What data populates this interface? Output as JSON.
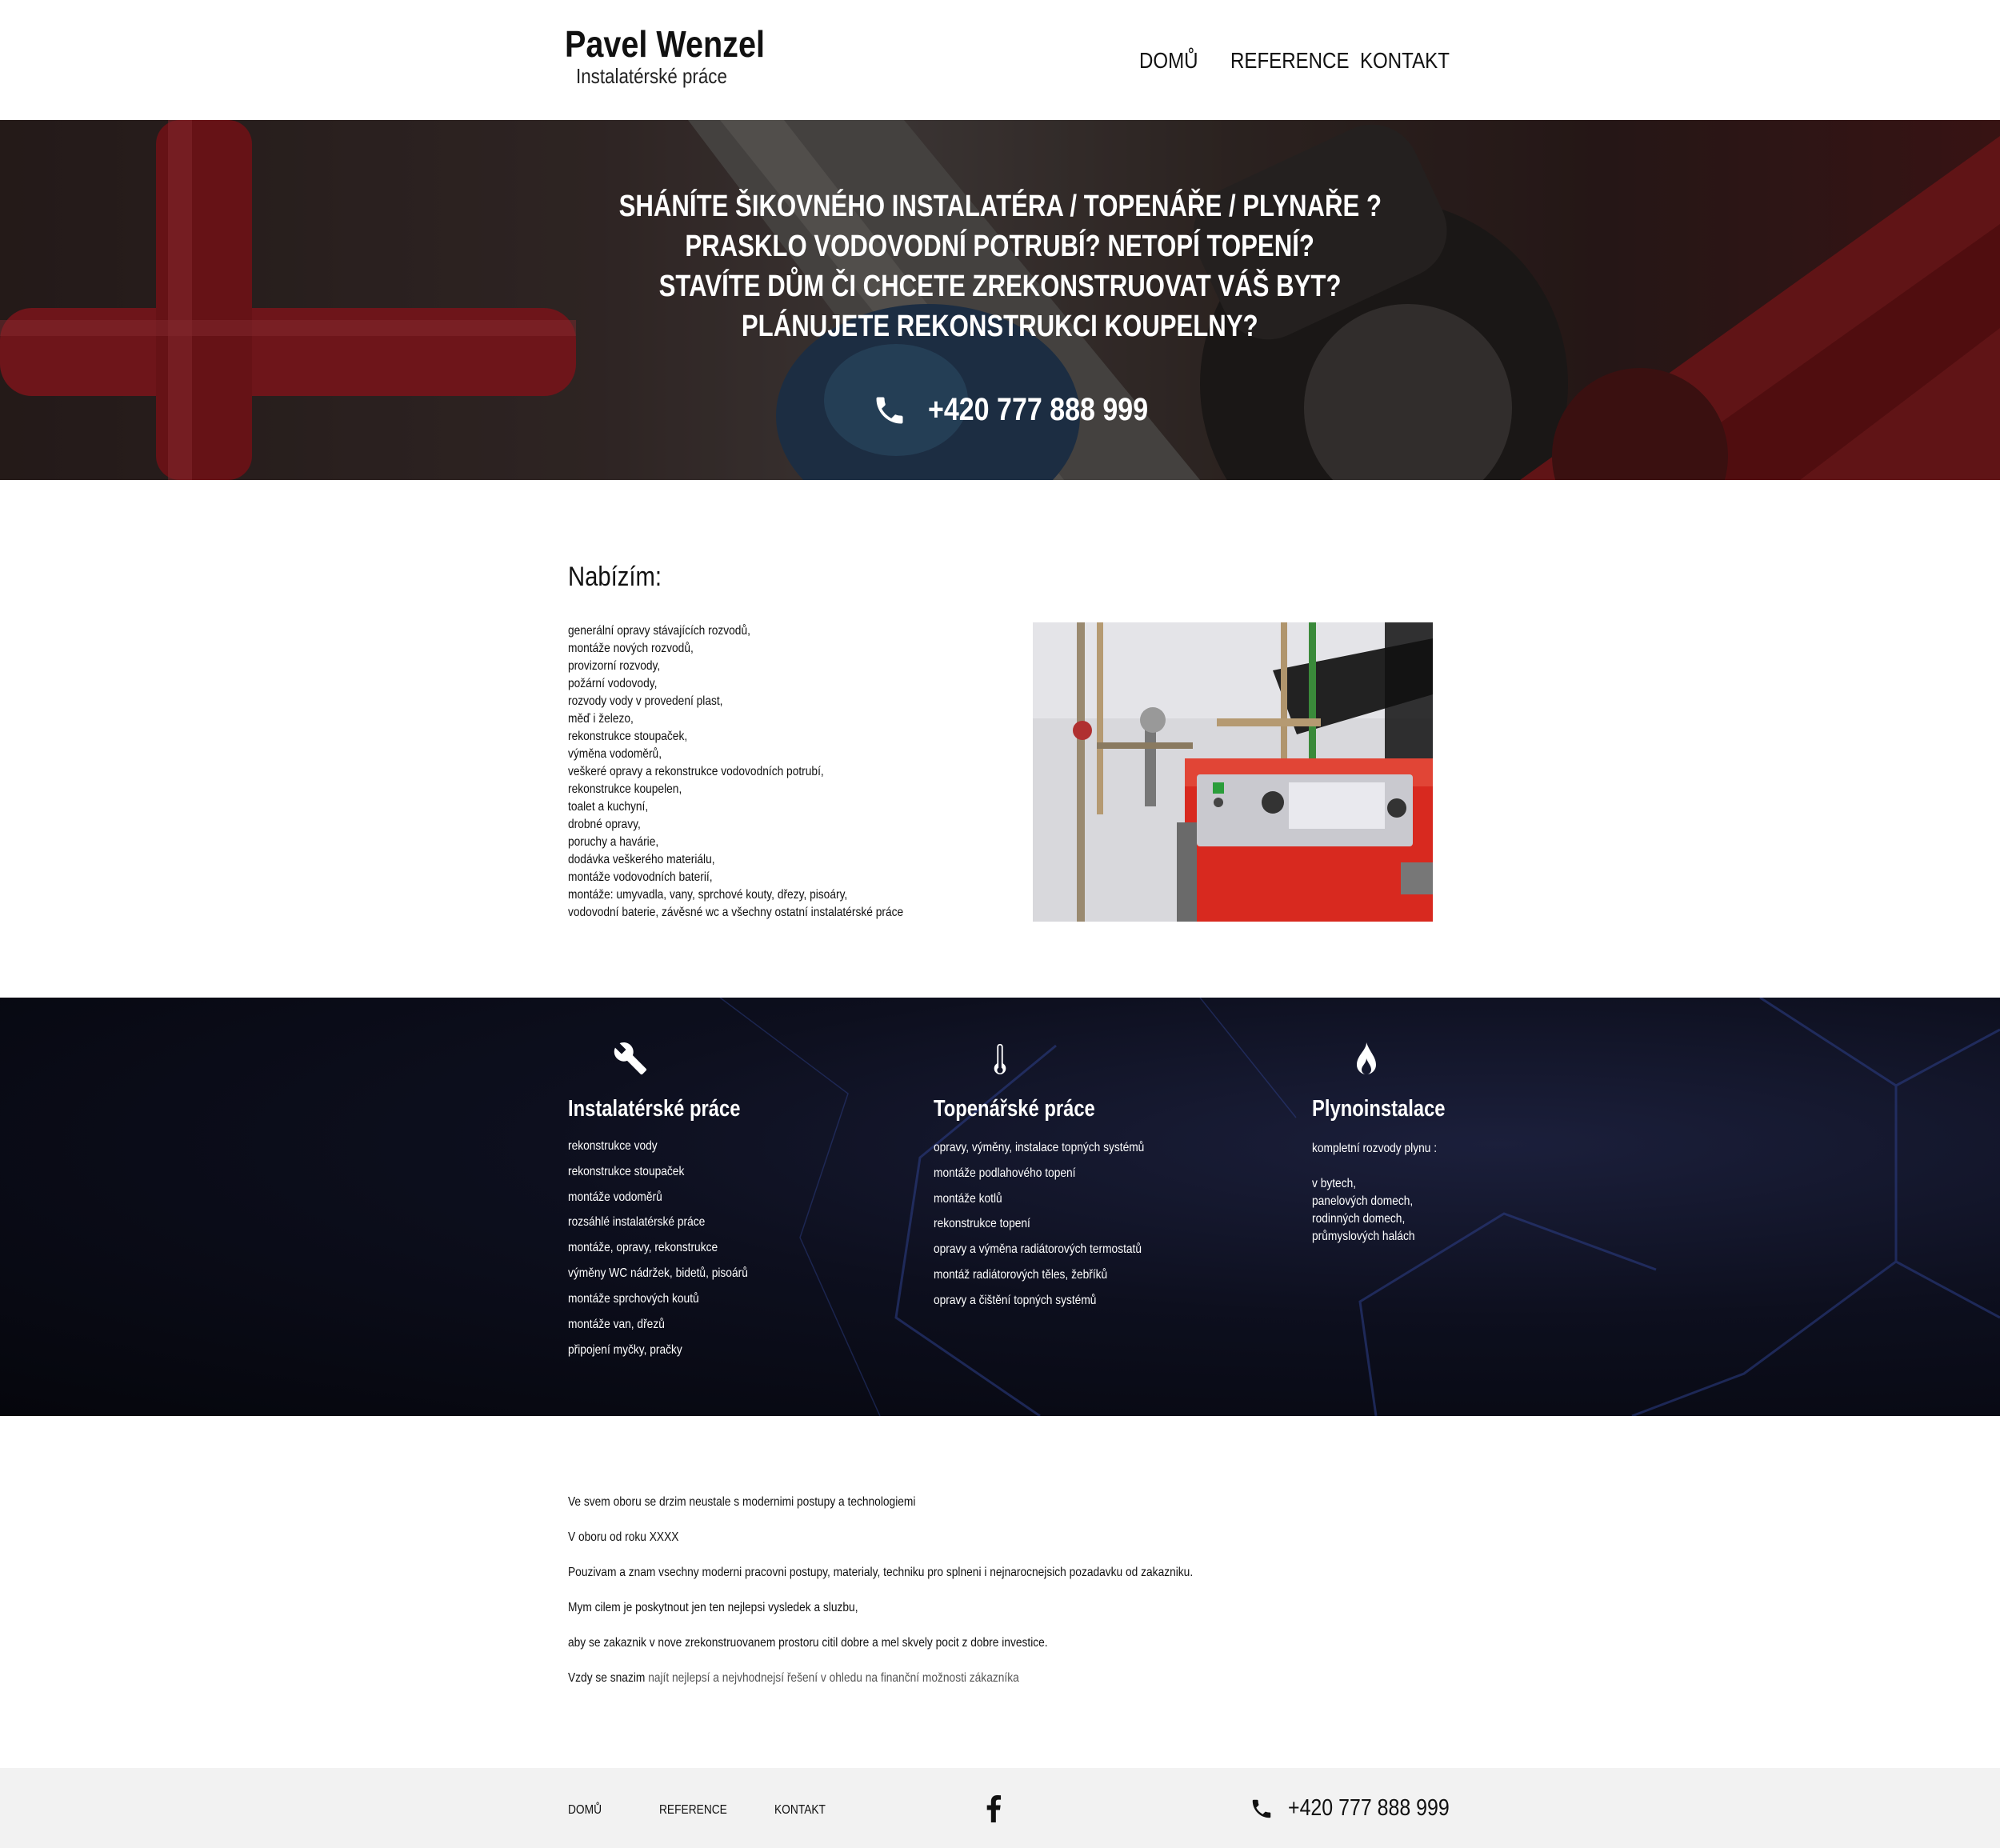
{
  "header": {
    "logo_name": "Pavel Wenzel",
    "logo_sub": "Instalatérské práce",
    "nav": [
      "DOMŮ",
      "REFERENCE",
      "KONTAKT"
    ]
  },
  "hero": {
    "lines": [
      "SHÁNÍTE ŠIKOVNÉHO INSTALATÉRA / TOPENÁŘE / PLYNAŘE ?",
      "PRASKLO VODOVODNÍ POTRUBÍ? NETOPÍ TOPENÍ?",
      "STAVÍTE DŮM ČI CHCETE ZREKONSTRUOVAT VÁŠ BYT?",
      "PLÁNUJETE REKONSTRUKCI KOUPELNY?"
    ],
    "phone": "+420 777 888 999",
    "phone_icon": "phone-icon"
  },
  "offer": {
    "title": "Nabízím:",
    "items": [
      "generální opravy stávajících rozvodů,",
      "montáže nových rozvodů,",
      "provizorní rozvody,",
      "požární vodovody,",
      "rozvody vody v provedení plast,",
      "měď i železo,",
      "rekonstrukce stoupaček,",
      "výměna vodoměrů,",
      "veškeré opravy a rekonstrukce vodovodních potrubí,",
      "rekonstrukce koupelen,",
      "toalet a kuchyní,",
      "drobné opravy,",
      "poruchy a havárie,",
      "dodávka veškerého materiálu,",
      "montáže vodovodních baterií,",
      "montáže: umyvadla, vany, sprchové kouty, dřezy, pisoáry,",
      "vodovodní baterie, závěsné wc a všechny ostatní instalatérské práce"
    ]
  },
  "services": [
    {
      "icon": "wrench-icon",
      "title": "Instalatérské práce",
      "items": [
        "rekonstrukce vody",
        "rekonstrukce stoupaček",
        "montáže vodoměrů",
        "rozsáhlé instalatérské práce",
        "montáže, opravy, rekonstrukce",
        "výměny WC nádržek, bidetů, pisoárů",
        "montáže sprchových koutů",
        "montáže van, dřezů",
        "připojení myčky, pračky"
      ]
    },
    {
      "icon": "thermometer-icon",
      "title": "Topenářské práce",
      "items": [
        "opravy, výměny, instalace topných systémů",
        "montáže podlahového topení",
        "montáže kotlů",
        "rekonstrukce topení",
        "opravy a výměna radiátorových termostatů",
        "montáž radiátorových těles, žebříků",
        "opravy a čištění topných systémů"
      ]
    },
    {
      "icon": "flame-icon",
      "title": "Plynoinstalace",
      "items": [
        "kompletní rozvody plynu :",
        "v bytech,",
        "panelových domech,",
        "rodinných domech,",
        "průmyslových halách"
      ]
    }
  ],
  "about": {
    "lines": [
      "Ve svem oboru se drzim neustale s modernimi postupy a technologiemi",
      "V oboru od roku XXXX",
      "Pouzivam a znam vsechny moderni pracovni postupy, materialy, techniku pro splneni i nejnarocnejsich pozadavku od zakazniku.",
      "Mym cilem je poskytnout jen ten nejlepsi vysledek a sluzbu,",
      "aby se zakaznik v nove zrekonstruovanem prostoru citil dobre a mel skvely pocit z dobre investice."
    ],
    "last_prefix": "Vzdy se snazim",
    "last_suffix": "najít nejlepsí a nejvhodnejsí řešení v ohledu na finanční možnosti zákazníka"
  },
  "footer": {
    "nav": [
      "DOMŮ",
      "REFERENCE",
      "KONTAKT"
    ],
    "social_icon": "facebook-icon",
    "phone_icon": "phone-icon",
    "phone": "+420 777 888 999"
  }
}
